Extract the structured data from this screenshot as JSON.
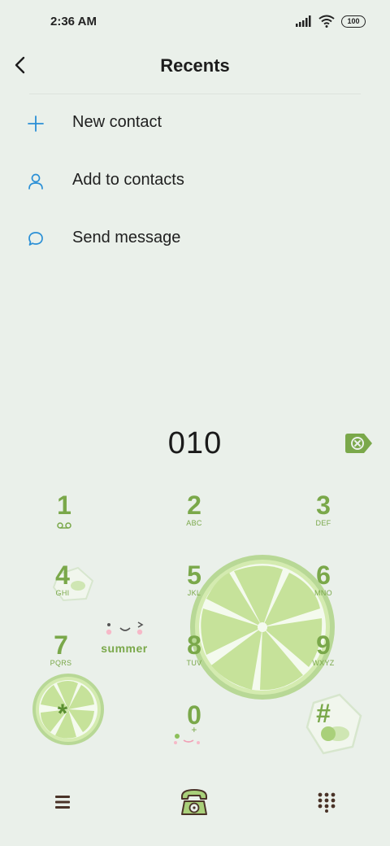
{
  "status": {
    "time": "2:36 AM",
    "battery": "100"
  },
  "header": {
    "title": "Recents"
  },
  "options": [
    {
      "label": "New contact",
      "icon": "plus-icon"
    },
    {
      "label": "Add to contacts",
      "icon": "person-icon"
    },
    {
      "label": "Send message",
      "icon": "message-bubble-icon"
    }
  ],
  "dialer": {
    "number": "010"
  },
  "keypad": [
    {
      "digit": "1",
      "letters": ""
    },
    {
      "digit": "2",
      "letters": "ABC"
    },
    {
      "digit": "3",
      "letters": "DEF"
    },
    {
      "digit": "4",
      "letters": "GHI"
    },
    {
      "digit": "5",
      "letters": "JKL"
    },
    {
      "digit": "6",
      "letters": "MNO"
    },
    {
      "digit": "7",
      "letters": "PQRS"
    },
    {
      "digit": "8",
      "letters": "TUV"
    },
    {
      "digit": "9",
      "letters": "WXYZ"
    },
    {
      "digit": "*",
      "letters": ""
    },
    {
      "digit": "0",
      "letters": "+"
    },
    {
      "digit": "#",
      "letters": ""
    }
  ],
  "decoration": {
    "sticker_text": "summer"
  },
  "colors": {
    "accent_blue": "#2a8fd6",
    "key_green": "#7aa84a",
    "lime_light": "#d4ebb0",
    "lime_rind": "#b8d896",
    "background": "#eaf0ea"
  }
}
